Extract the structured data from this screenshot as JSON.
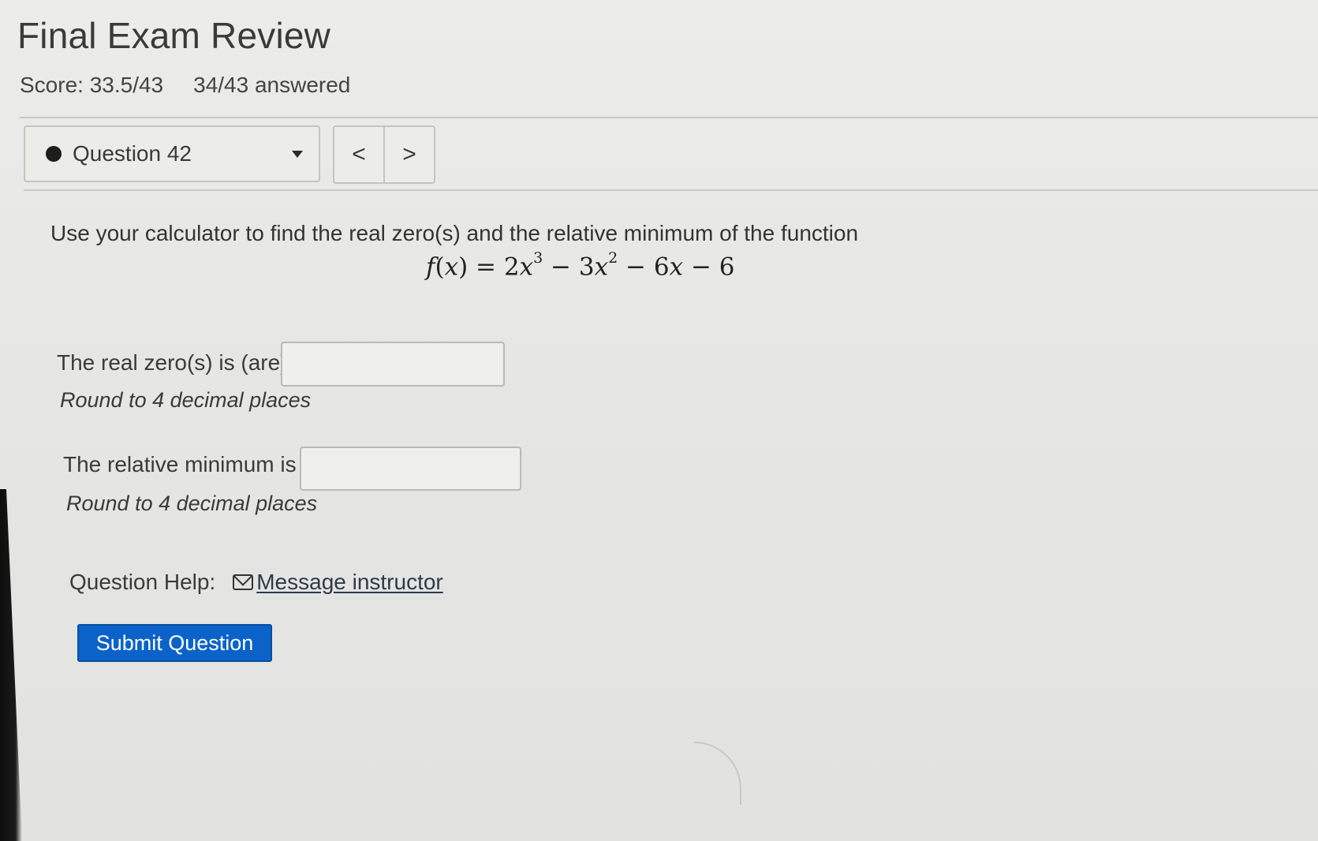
{
  "header": {
    "title": "Final Exam Review",
    "score": "Score: 33.5/43",
    "answered": "34/43 answered"
  },
  "question_nav": {
    "current": "Question 42",
    "prev_symbol": "<",
    "next_symbol": ">"
  },
  "question": {
    "prompt": "Use your calculator to find the real zero(s) and the relative minimum of the function",
    "formula": {
      "lhs_fn": "f",
      "lhs_var": "x",
      "parts": [
        "2",
        "x",
        "3",
        "− 3",
        "x",
        "2",
        "− 6",
        "x",
        "− 6"
      ]
    },
    "fields": [
      {
        "label": "The real zero(s) is (are)",
        "note": "Round to 4 decimal places",
        "value": ""
      },
      {
        "label": "The relative minimum is",
        "note": "Round to 4 decimal places",
        "value": ""
      }
    ]
  },
  "help": {
    "label": "Question Help:",
    "link": "Message instructor",
    "icon": "mail-icon"
  },
  "submit": {
    "label": "Submit Question",
    "color": "#0b63c9"
  }
}
